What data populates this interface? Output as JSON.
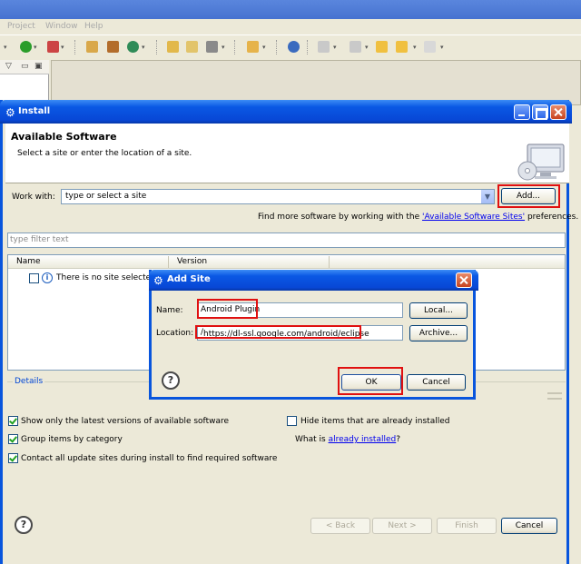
{
  "background": {
    "menu": [
      "Project",
      "Window",
      "Help"
    ],
    "view_tab_icons": [
      "view-menu-icon",
      "minimize-icon",
      "maximize-icon"
    ]
  },
  "install": {
    "title": "Install",
    "heading": "Available Software",
    "description": "Select a site or enter the location of a site.",
    "work_with_label": "Work with:",
    "work_with_value": "type or select a site",
    "add_button": "Add...",
    "find_more_prefix": "Find more software by working with the ",
    "find_more_link": "'Available Software Sites'",
    "find_more_suffix": " preferences.",
    "filter_placeholder": "type filter text",
    "columns": [
      "Name",
      "Version"
    ],
    "row_text": "There is no site selected.",
    "details_label": "Details",
    "options": {
      "latest_versions": "Show only the latest versions of available software",
      "hide_installed": "Hide items that are already installed",
      "group_by_category": "Group items by category",
      "what_is_prefix": "What is ",
      "what_is_link": "already installed",
      "what_is_suffix": "?",
      "contact_all_sites": "Contact all update sites during install to find required software"
    },
    "buttons": {
      "back": "< Back",
      "next": "Next >",
      "finish": "Finish",
      "cancel": "Cancel"
    }
  },
  "add_site": {
    "title": "Add Site",
    "name_label": "Name:",
    "name_value": "Android Plugin",
    "location_label": "Location:",
    "location_value": "https://dl-ssl.google.com/android/eclipse",
    "location_suffix": "/",
    "local_button": "Local...",
    "archive_button": "Archive...",
    "ok_button": "OK",
    "cancel_button": "Cancel"
  },
  "colors": {
    "titlebar": "#0a58e4",
    "highlight": "#e01010",
    "link": "#0000ee"
  }
}
